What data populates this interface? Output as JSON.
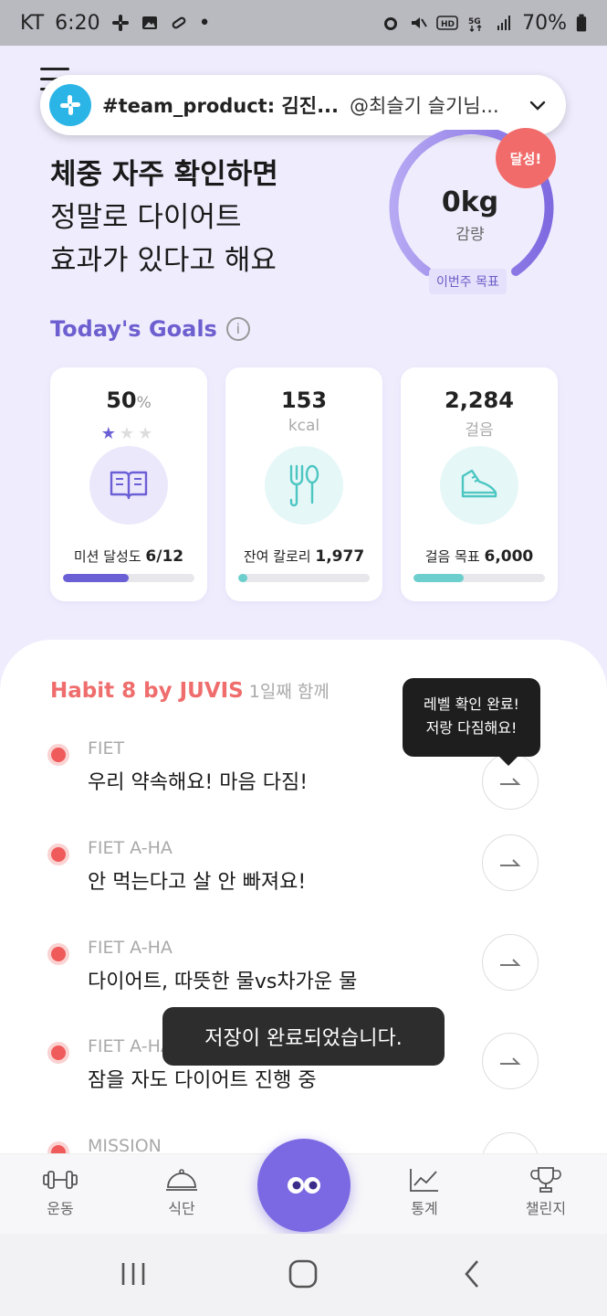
{
  "status_bar": {
    "carrier": "KT",
    "time": "6:20",
    "battery": "70%"
  },
  "notification": {
    "channel": "#team_product: 김진...",
    "message": "@최슬기 슬기님..."
  },
  "headline": {
    "line1": "체중 자주 확인하면",
    "line2": "정말로 다이어트",
    "line3": "효과가 있다고 해요"
  },
  "weight": {
    "value": "0kg",
    "unit": "감량",
    "goal_label": "이번주 목표",
    "achieved_badge": "달성!"
  },
  "goals": {
    "title": "Today's Goals",
    "mission": {
      "value": "50",
      "unit": "%",
      "caption": "미션 달성도",
      "caption_value": "6/12",
      "progress": 0.5
    },
    "calories": {
      "value": "153",
      "unit": "kcal",
      "caption": "잔여 칼로리",
      "caption_value": "1,977",
      "progress": 0.07
    },
    "steps": {
      "value": "2,284",
      "unit": "걸음",
      "caption": "걸음 목표",
      "caption_value": "6,000",
      "progress": 0.38
    }
  },
  "habit": {
    "title": "Habit 8 by JUVIS",
    "day": "1일째 함께",
    "items": [
      {
        "tag": "FIET",
        "title": "우리 약속해요! 마음 다짐!"
      },
      {
        "tag": "FIET A-HA",
        "title": "안 먹는다고 살 안 빠져요!"
      },
      {
        "tag": "FIET A-HA",
        "title": "다이어트, 따뜻한 물vs차가운 물"
      },
      {
        "tag": "FIET A-HA",
        "title": "잠을 자도 다이어트 진행 중"
      },
      {
        "tag": "MISSION",
        "title": ""
      }
    ]
  },
  "tooltip": {
    "line1": "레벨 확인 완료!",
    "line2": "저랑 다짐해요!"
  },
  "toast": "저장이 완료되었습니다.",
  "bottom_nav": {
    "exercise": "운동",
    "diet": "식단",
    "stats": "통계",
    "challenge": "챌린지"
  },
  "colors": {
    "accent": "#6d5fd0",
    "habit": "#ef6d6d",
    "teal": "#6ccfcd"
  }
}
